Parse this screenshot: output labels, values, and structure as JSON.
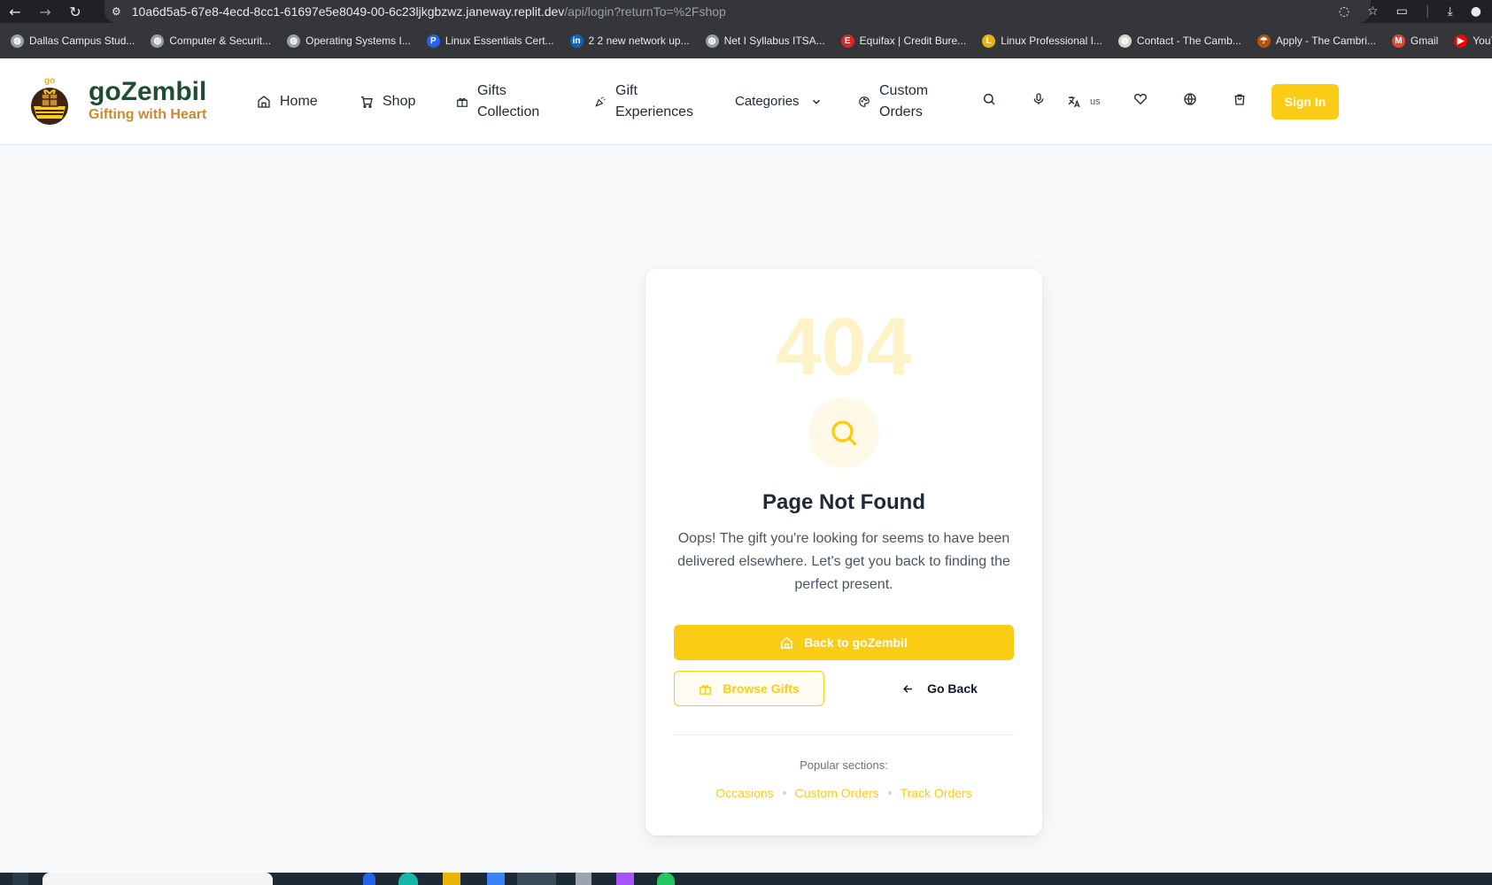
{
  "browser": {
    "url_host": "10a6d5a5-67e8-4ecd-8cc1-61697e5e8049-00-6c23ljkgbzwz.janeway.replit.dev",
    "url_path": "/api/login?returnTo=%2Fshop",
    "bookmarks": [
      {
        "label": "Dallas Campus Stud...",
        "icon": "globe-icon",
        "color": "#9aa0a6"
      },
      {
        "label": "Computer & Securit...",
        "icon": "globe-icon",
        "color": "#9aa0a6"
      },
      {
        "label": "Operating Systems I...",
        "icon": "globe-icon",
        "color": "#9aa0a6"
      },
      {
        "label": "Linux Essentials Cert...",
        "icon": "p-icon",
        "color": "#2563eb"
      },
      {
        "label": "2 2 new network up...",
        "icon": "linkedin-icon",
        "color": "#0a66c2"
      },
      {
        "label": "Net I Syllabus ITSA...",
        "icon": "globe-icon",
        "color": "#9aa0a6"
      },
      {
        "label": "Equifax | Credit Bure...",
        "icon": "equifax-icon",
        "color": "#dc2626"
      },
      {
        "label": "Linux Professional I...",
        "icon": "lpi-icon",
        "color": "#eab308"
      },
      {
        "label": "Contact - The Camb...",
        "icon": "globe-icon",
        "color": "#d6d3d1"
      },
      {
        "label": "Apply - The Cambri...",
        "icon": "umbrella-icon",
        "color": "#b45309"
      },
      {
        "label": "Gmail",
        "icon": "gmail-icon",
        "color": "#ea4335"
      },
      {
        "label": "YouTube",
        "icon": "youtube-icon",
        "color": "#ff0000"
      }
    ]
  },
  "header": {
    "brand_name": "goZembil",
    "brand_tagline": "Gifting with Heart",
    "nav": {
      "home": "Home",
      "shop": "Shop",
      "gifts_line1": "Gifts",
      "gifts_line2": "Collection",
      "experiences_line1": "Gift",
      "experiences_line2": "Experiences",
      "categories": "Categories",
      "custom_line1": "Custom",
      "custom_line2": "Orders"
    },
    "language": "us",
    "sign_in": "Sign In"
  },
  "error": {
    "code": "404",
    "title": "Page Not Found",
    "description": "Oops! The gift you're looking for seems to have been delivered elsewhere. Let's get you back to finding the perfect present.",
    "primary_button": "Back to goZembil",
    "browse_button": "Browse Gifts",
    "back_button": "Go Back",
    "popular_label": "Popular sections:",
    "links": [
      "Occasions",
      "Custom Orders",
      "Track Orders"
    ]
  },
  "colors": {
    "accent": "#facc15",
    "brand_green": "#1f4d34",
    "brand_orange": "#c98a2e"
  }
}
